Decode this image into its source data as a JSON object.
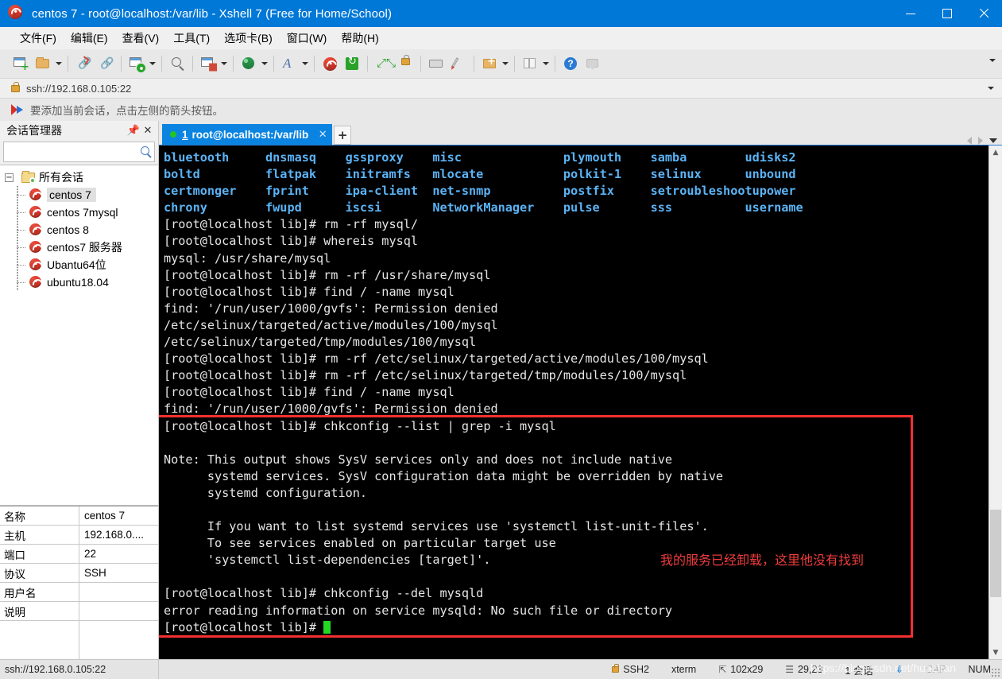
{
  "window": {
    "title": "centos 7 - root@localhost:/var/lib - Xshell 7 (Free for Home/School)",
    "app_icon": "xshell-spiral-icon",
    "minimize_label": "—",
    "maximize_label": "□",
    "close_label": "✕"
  },
  "menubar": {
    "items": [
      {
        "label": "文件(F)",
        "name": "menu-file"
      },
      {
        "label": "编辑(E)",
        "name": "menu-edit"
      },
      {
        "label": "查看(V)",
        "name": "menu-view"
      },
      {
        "label": "工具(T)",
        "name": "menu-tools"
      },
      {
        "label": "选项卡(B)",
        "name": "menu-tabs"
      },
      {
        "label": "窗口(W)",
        "name": "menu-window"
      },
      {
        "label": "帮助(H)",
        "name": "menu-help"
      }
    ]
  },
  "toolbar": {
    "icons": [
      "new-session-icon",
      "open-folder-icon",
      "disconnect-icon",
      "reconnect-icon",
      "session-properties-icon",
      "find-icon",
      "transfer-file-icon",
      "web-browser-icon",
      "font-icon",
      "xshell-icon",
      "xftp-icon",
      "fullscreen-icon",
      "lock-icon",
      "keyboard-icon",
      "highlight-icon",
      "new-folder-icon",
      "layout-panes-icon",
      "help-icon",
      "feedback-icon"
    ],
    "overflow_label": "▼"
  },
  "address": {
    "value": "ssh://192.168.0.105:22",
    "lock_icon": "lock-icon",
    "dropdown_icon": "chevron-down-icon"
  },
  "notice": {
    "icon": "flag-icon",
    "text": "要添加当前会话，点击左侧的箭头按钮。"
  },
  "sidebar": {
    "title": "会话管理器",
    "pin_icon": "pin-icon",
    "close_icon": "close-icon",
    "search": {
      "value": "",
      "placeholder": "",
      "icon": "search-icon"
    },
    "tree": {
      "root_label": "所有会话",
      "root_icon": "folder-settings-icon",
      "expander": "−",
      "items": [
        {
          "label": "centos 7",
          "selected": true
        },
        {
          "label": "centos 7mysql",
          "selected": false
        },
        {
          "label": "centos 8",
          "selected": false
        },
        {
          "label": "centos7 服务器",
          "selected": false
        },
        {
          "label": "Ubantu64位",
          "selected": false
        },
        {
          "label": "ubuntu18.04",
          "selected": false
        }
      ]
    },
    "properties": [
      {
        "key": "名称",
        "value": "centos 7"
      },
      {
        "key": "主机",
        "value": "192.168.0...."
      },
      {
        "key": "端口",
        "value": "22"
      },
      {
        "key": "协议",
        "value": "SSH"
      },
      {
        "key": "用户名",
        "value": ""
      },
      {
        "key": "说明",
        "value": ""
      }
    ]
  },
  "tabs": {
    "active": {
      "number": "1",
      "label": "root@localhost:/var/lib",
      "status_dot": "connected-dot",
      "close_label": "✕"
    },
    "new_tab_label": "+",
    "nav_prev_icon": "chevron-left-icon",
    "nav_next_icon": "chevron-right-icon",
    "nav_menu_icon": "chevron-down-icon"
  },
  "terminal": {
    "listing_rows": [
      [
        "bluetooth",
        "dnsmasq",
        "gssproxy",
        "misc",
        "plymouth",
        "samba",
        "udisks2"
      ],
      [
        "boltd",
        "flatpak",
        "initramfs",
        "mlocate",
        "polkit-1",
        "selinux",
        "unbound"
      ],
      [
        "certmonger",
        "fprint",
        "ipa-client",
        "net-snmp",
        "postfix",
        "setroubleshoot",
        "upower"
      ],
      [
        "chrony",
        "fwupd",
        "iscsi",
        "NetworkManager",
        "pulse",
        "sss",
        "username"
      ]
    ],
    "lines": [
      "[root@localhost lib]# rm -rf mysql/",
      "[root@localhost lib]# whereis mysql",
      "mysql: /usr/share/mysql",
      "[root@localhost lib]# rm -rf /usr/share/mysql",
      "[root@localhost lib]# find / -name mysql",
      "find: '/run/user/1000/gvfs': Permission denied",
      "/etc/selinux/targeted/active/modules/100/mysql",
      "/etc/selinux/targeted/tmp/modules/100/mysql",
      "[root@localhost lib]# rm -rf /etc/selinux/targeted/active/modules/100/mysql",
      "[root@localhost lib]# rm -rf /etc/selinux/targeted/tmp/modules/100/mysql",
      "[root@localhost lib]# find / -name mysql",
      "find: '/run/user/1000/gvfs': Permission denied"
    ],
    "boxed_lines": [
      "[root@localhost lib]# chkconfig --list | grep -i mysql",
      "",
      "Note: This output shows SysV services only and does not include native",
      "      systemd services. SysV configuration data might be overridden by native",
      "      systemd configuration.",
      "",
      "      If you want to list systemd services use 'systemctl list-unit-files'.",
      "      To see services enabled on particular target use",
      "      'systemctl list-dependencies [target]'.",
      "",
      "[root@localhost lib]# chkconfig --del mysqld",
      "error reading information on service mysqld: No such file or directory"
    ],
    "prompt_line": "[root@localhost lib]# ",
    "annotation": "我的服务已经卸载，这里他没有找到",
    "colors": {
      "background": "#000000",
      "foreground": "#e6e6e6",
      "directory": "#5bb3f5",
      "cursor": "#23d923",
      "annotation": "#f03c3c",
      "highlight_box": "#f23030"
    }
  },
  "statusbar": {
    "connection": "ssh://192.168.0.105:22",
    "protocol": "SSH2",
    "terminal_type": "xterm",
    "size": "102x29",
    "cursor_pos": "29,23",
    "sessions": "1 会话",
    "cap": "CAP",
    "num": "NUM",
    "lock_icon": "lock-icon",
    "size_icon": "resize-icon",
    "pos_icon": "cursor-icon",
    "transfer_icon": "download-arrow-icon",
    "grip_icon": "resize-grip-icon"
  },
  "watermark": "https://blog.csdn.net/huaziran"
}
